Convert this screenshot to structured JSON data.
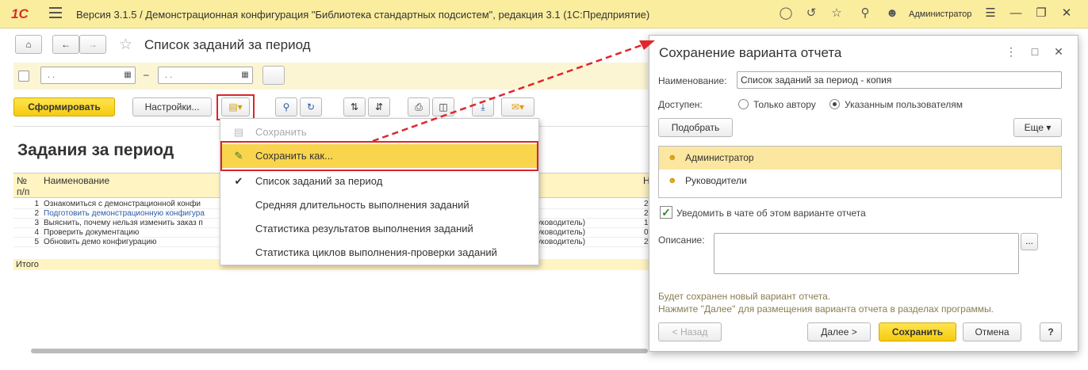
{
  "titlebar": {
    "logo": "1С",
    "title": "Версия 3.1.5 / Демонстрационная конфигурация \"Библиотека стандартных подсистем\", редакция 3.1  (1С:Предприятие)",
    "username": "Администратор",
    "icons": [
      "bell-icon",
      "history-icon",
      "star-icon",
      "search-icon",
      "user-icon",
      "menu-icon"
    ]
  },
  "form": {
    "title": "Список заданий за период",
    "date_placeholder": " .  .",
    "dash": "–",
    "generate_label": "Сформировать",
    "settings_label": "Настройки..."
  },
  "report": {
    "title": "Задания за период",
    "col_num": "№",
    "col_num2": "п/п",
    "col_name": "Наименование",
    "col_right": "Н",
    "rows": [
      {
        "n": "1",
        "name": "Ознакомиться с демонстрационной конфи",
        "extra": "",
        "right": "2"
      },
      {
        "n": "2",
        "name": "Подготовить демонстрационную конфигура",
        "extra": "",
        "right": "2"
      },
      {
        "n": "3",
        "name": "Выяснить, почему нельзя изменить заказ п",
        "extra": "уководитель)",
        "right": "1"
      },
      {
        "n": "4",
        "name": "Проверить документацию",
        "extra": "уководитель)",
        "right": "0"
      },
      {
        "n": "5",
        "name": "Обновить демо конфигурацию",
        "extra": "уководитель)",
        "right": "2"
      }
    ],
    "total_label": "Итого"
  },
  "menu": {
    "items": [
      {
        "label": "Сохранить",
        "icon": "save-icon",
        "state": "disabled"
      },
      {
        "label": "Сохранить как...",
        "icon": "save-as-icon",
        "state": "selected"
      },
      {
        "label": "Список заданий за период",
        "icon": "check-icon",
        "state": "checked"
      },
      {
        "label": "Средняя длительность выполнения заданий",
        "icon": "",
        "state": ""
      },
      {
        "label": "Статистика результатов выполнения заданий",
        "icon": "",
        "state": ""
      },
      {
        "label": "Статистика циклов выполнения-проверки заданий",
        "icon": "",
        "state": ""
      }
    ]
  },
  "dialog": {
    "title": "Сохранение варианта отчета",
    "name_label": "Наименование:",
    "name_value": "Список заданий за период - копия",
    "available_label": "Доступен:",
    "radio_author": "Только автору",
    "radio_users": "Указанным пользователям",
    "pick_label": "Подобрать",
    "more_label": "Еще",
    "users": [
      {
        "label": "Администратор",
        "selected": true
      },
      {
        "label": "Руководители",
        "selected": false
      }
    ],
    "notify_label": "Уведомить в чате об этом варианте отчета",
    "description_label": "Описание:",
    "ellipsis": "...",
    "info_line1": "Будет сохранен новый вариант отчета.",
    "info_line2": "Нажмите \"Далее\" для размещения варианта отчета в разделах программы.",
    "back_label": "< Назад",
    "next_label": "Далее >",
    "save_label": "Сохранить",
    "cancel_label": "Отмена",
    "help_label": "?"
  },
  "colors": {
    "accent_yellow": "#f5cb0e",
    "highlight_red": "#d9262c",
    "titlebar_bg": "#fbed9e"
  }
}
